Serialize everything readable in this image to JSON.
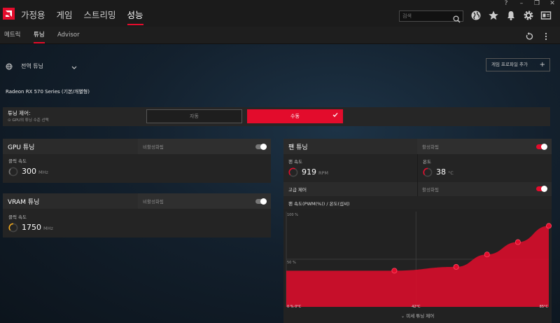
{
  "topbar": {
    "nav": [
      "가정용",
      "게임",
      "스트리밍",
      "성능"
    ],
    "active_nav": "성능",
    "search_placeholder": "검색",
    "window_controls": [
      "?",
      "–",
      "❐",
      "✕"
    ]
  },
  "subnav": {
    "tabs": [
      "메트릭",
      "튜닝",
      "Advisor"
    ],
    "active_tab": "튜닝"
  },
  "profile": {
    "name": "전역 튜닝",
    "add_profile_label": "게임 프로파일 추가",
    "gpu_name": "Radeon RX 570 Series (기본/개별형)"
  },
  "tuning_control": {
    "title": "튜닝 제어:",
    "subtitle": "⊙ GPU의 튜닝 수준 선택",
    "auto_label": "자동",
    "manual_label": "수동",
    "selected": "수동"
  },
  "gpu_tuning": {
    "title": "GPU 튜닝",
    "state": "비활성화됨",
    "enabled": false,
    "clock_label": "클럭 속도",
    "clock_value": "300",
    "clock_unit": "MHz"
  },
  "vram_tuning": {
    "title": "VRAM 튜닝",
    "state": "비활성화됨",
    "enabled": false,
    "clock_label": "클럭 속도",
    "clock_value": "1750",
    "clock_unit": "MHz"
  },
  "fan_tuning": {
    "title": "팬 튜닝",
    "state": "활성화됨",
    "enabled": true,
    "fan_speed_label": "팬 속도",
    "fan_speed_value": "919",
    "fan_speed_unit": "RPM",
    "temp_label": "온도",
    "temp_value": "38",
    "temp_unit": "°C",
    "advanced_label": "고급 제어",
    "advanced_state": "활성화됨",
    "advanced_enabled": true,
    "chart_title": "팬 속도(PWM(%)) / 온도(섭씨)",
    "fine_tune_label": "미세 튜닝 제어"
  },
  "colors": {
    "accent": "#e30c2c",
    "gauge_yellow": "#f0a81c"
  },
  "chart_data": {
    "type": "area",
    "title": "팬 속도(PWM(%)) / 온도(섭씨)",
    "x_tick_labels": [
      "0 % 0°C",
      "42°C",
      "85°C"
    ],
    "y_tick_labels": [
      "100 %",
      "50 %"
    ],
    "x": [
      0,
      35,
      55,
      65,
      75,
      85
    ],
    "values": [
      38,
      38,
      42,
      55,
      68,
      85
    ],
    "points_shown_x": [
      35,
      55,
      65,
      75,
      85
    ],
    "xlim": [
      0,
      85
    ],
    "ylim": [
      0,
      100
    ],
    "grid": true
  }
}
